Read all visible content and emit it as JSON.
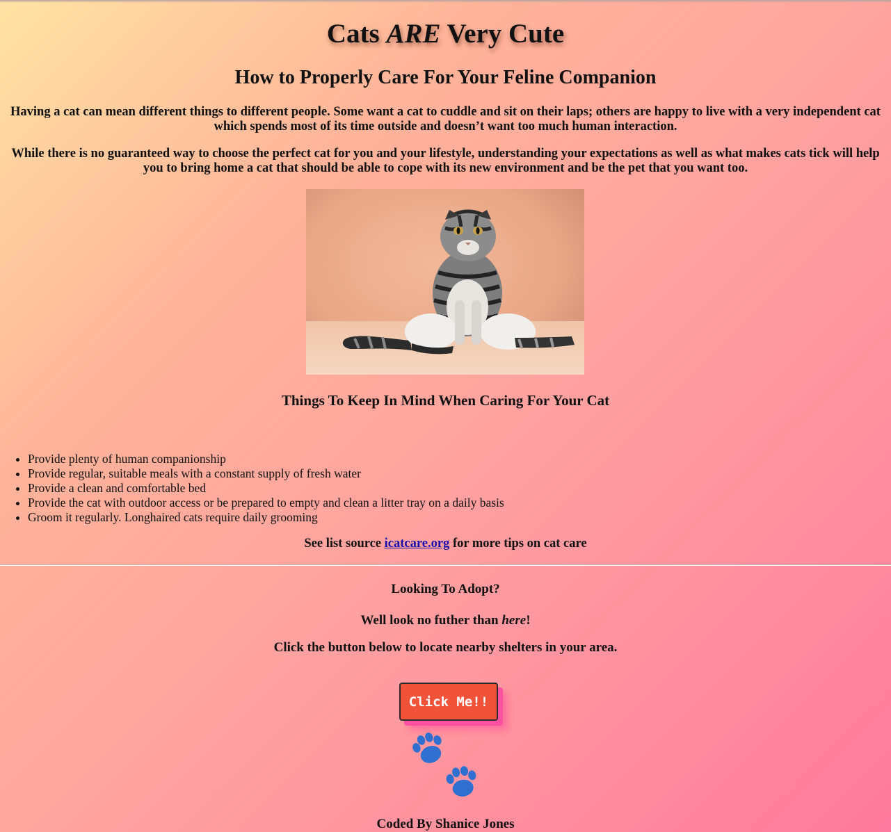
{
  "header": {
    "title_pre": "Cats ",
    "title_em": "ARE",
    "title_post": " Very Cute",
    "subtitle": "How to Properly Care For Your Feline Companion"
  },
  "intro": {
    "p1": "Having a cat can mean different things to different people. Some want a cat to cuddle and sit on their laps; others are happy to live with a very independent cat which spends most of its time outside and doesn’t want too much human interaction.",
    "p2": "While there is no guaranteed way to choose the perfect cat for you and your lifestyle, understanding your expectations as well as what makes cats tick will help you to bring home a cat that should be able to cope with its new environment and be the pet that you want too."
  },
  "tips": {
    "heading": "Things To Keep In Mind When Caring For Your Cat",
    "items": [
      "Provide plenty of human companionship",
      "Provide regular, suitable meals with a constant supply of fresh water",
      "Provide a clean and comfortable bed",
      "Provide the cat with outdoor access or be prepared to empty and clean a litter tray on a daily basis",
      "Groom it regularly. Longhaired cats require daily grooming"
    ],
    "source_pre": "See list source ",
    "source_link": "icatcare.org",
    "source_post": " for more tips on cat care"
  },
  "adopt": {
    "heading": "Looking To Adopt?",
    "further_pre": "Well look no futher than ",
    "further_em": "here",
    "further_post": "!",
    "instructions": "Click the button below to locate nearby shelters in your area.",
    "button_label": "Click Me!!"
  },
  "footer": {
    "credit": "Coded By Shanice Jones"
  },
  "colors": {
    "button": "#f0523a",
    "button_shadow": "#ff4fa0",
    "paw": "#2f6fcf",
    "link": "#1a0dab"
  },
  "icons": [
    "cat-photo",
    "paw-prints-icon"
  ]
}
